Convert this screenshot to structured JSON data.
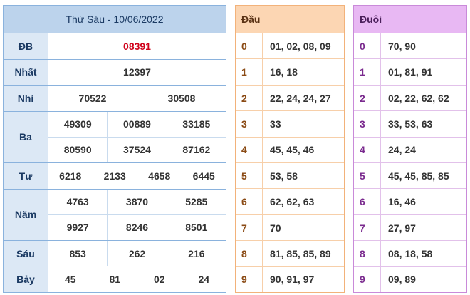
{
  "results": {
    "title": "Thứ Sáu - 10/06/2022",
    "prizes": [
      {
        "label": "ĐB",
        "special": true,
        "lines": [
          [
            "08391"
          ]
        ]
      },
      {
        "label": "Nhất",
        "lines": [
          [
            "12397"
          ]
        ]
      },
      {
        "label": "Nhì",
        "lines": [
          [
            "70522",
            "30508"
          ]
        ]
      },
      {
        "label": "Ba",
        "lines": [
          [
            "49309",
            "00889",
            "33185"
          ],
          [
            "80590",
            "37524",
            "87162"
          ]
        ]
      },
      {
        "label": "Tư",
        "lines": [
          [
            "6218",
            "2133",
            "4658",
            "6445"
          ]
        ]
      },
      {
        "label": "Năm",
        "lines": [
          [
            "4763",
            "3870",
            "5285"
          ],
          [
            "9927",
            "8246",
            "8501"
          ]
        ]
      },
      {
        "label": "Sáu",
        "lines": [
          [
            "853",
            "262",
            "216"
          ]
        ]
      },
      {
        "label": "Bảy",
        "lines": [
          [
            "45",
            "81",
            "02",
            "24"
          ]
        ]
      }
    ]
  },
  "dau": {
    "header": "Đầu",
    "rows": [
      {
        "digit": "0",
        "values": "01, 02, 08, 09"
      },
      {
        "digit": "1",
        "values": "16, 18"
      },
      {
        "digit": "2",
        "values": "22, 24, 24, 27"
      },
      {
        "digit": "3",
        "values": "33"
      },
      {
        "digit": "4",
        "values": "45, 45, 46"
      },
      {
        "digit": "5",
        "values": "53, 58"
      },
      {
        "digit": "6",
        "values": "62, 62, 63"
      },
      {
        "digit": "7",
        "values": "70"
      },
      {
        "digit": "8",
        "values": "81, 85, 85, 89"
      },
      {
        "digit": "9",
        "values": "90, 91, 97"
      }
    ]
  },
  "duoi": {
    "header": "Đuôi",
    "rows": [
      {
        "digit": "0",
        "values": "70, 90"
      },
      {
        "digit": "1",
        "values": "01, 81, 91"
      },
      {
        "digit": "2",
        "values": "02, 22, 62, 62"
      },
      {
        "digit": "3",
        "values": "33, 53, 63"
      },
      {
        "digit": "4",
        "values": "24, 24"
      },
      {
        "digit": "5",
        "values": "45, 45, 85, 85"
      },
      {
        "digit": "6",
        "values": "16, 46"
      },
      {
        "digit": "7",
        "values": "27, 97"
      },
      {
        "digit": "8",
        "values": "08, 18, 58"
      },
      {
        "digit": "9",
        "values": "09, 89"
      }
    ]
  },
  "colors": {
    "results_border": "#8ab2dd",
    "results_header_bg": "#bcd3ec",
    "special_number": "#d0021b",
    "dau_header_bg": "#fcd6b3",
    "duoi_header_bg": "#e8b8f3"
  }
}
